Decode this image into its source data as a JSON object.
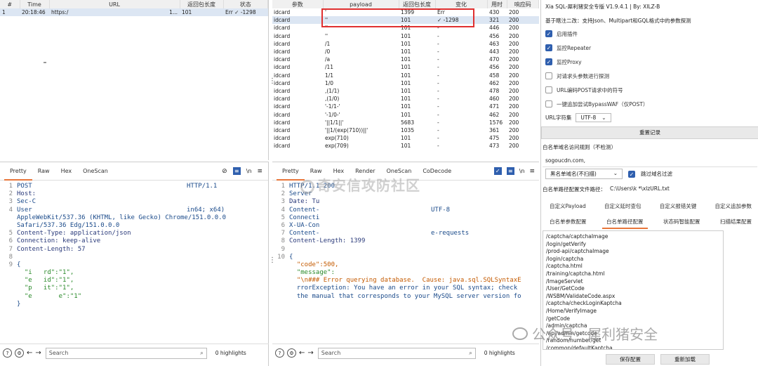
{
  "history": {
    "columns": [
      "#",
      "Time",
      "URL",
      "返回包长度",
      "状态"
    ],
    "rows": [
      {
        "num": "1",
        "time": "20:18:46",
        "url": "https:/",
        "extra": "1...",
        "len": "101",
        "status": "Err ✓ -1298"
      }
    ]
  },
  "results": {
    "columns": [
      "参数",
      "payload",
      "返回包长度",
      "变化",
      "用时",
      "响应码"
    ],
    "rows": [
      [
        "idcard",
        "'",
        "1399",
        "Err",
        "430",
        "200"
      ],
      [
        "idcard",
        "''",
        "101",
        "✓ -1298",
        "321",
        "200"
      ],
      [
        "idcard",
        "''",
        "101",
        "-",
        "446",
        "200"
      ],
      [
        "idcard",
        "''",
        "101",
        "-",
        "456",
        "200"
      ],
      [
        "idcard",
        "/1",
        "101",
        "-",
        "463",
        "200"
      ],
      [
        "idcard",
        "/0",
        "101",
        "-",
        "443",
        "200"
      ],
      [
        "idcard",
        "/a",
        "101",
        "-",
        "470",
        "200"
      ],
      [
        "idcard",
        "/11",
        "101",
        "-",
        "456",
        "200"
      ],
      [
        "idcard",
        "1/1",
        "101",
        "-",
        "458",
        "200"
      ],
      [
        "idcard",
        "1/0",
        "101",
        "-",
        "462",
        "200"
      ],
      [
        "idcard",
        ",(1/1)",
        "101",
        "-",
        "478",
        "200"
      ],
      [
        "idcard",
        ",(1/0)",
        "101",
        "-",
        "460",
        "200"
      ],
      [
        "idcard",
        "'-1/1-'",
        "101",
        "-",
        "471",
        "200"
      ],
      [
        "idcard",
        "'-1/0-'",
        "101",
        "-",
        "462",
        "200"
      ],
      [
        "idcard",
        "'||1/1||'",
        "5683",
        "-",
        "1576",
        "200"
      ],
      [
        "idcard",
        "'||1/(exp(710))||'",
        "1035",
        "-",
        "361",
        "200"
      ],
      [
        "idcard",
        "exp(710)",
        "101",
        "-",
        "475",
        "200"
      ],
      [
        "idcard",
        "exp(709)",
        "101",
        "-",
        "473",
        "200"
      ]
    ]
  },
  "request": {
    "tabs": [
      "Pretty",
      "Raw",
      "Hex",
      "OneScan"
    ],
    "lines": [
      {
        "n": "1",
        "t": "POST",
        "t2": "HTTP/1.1"
      },
      {
        "n": "2",
        "t": "Host:"
      },
      {
        "n": "3",
        "t": "Sec-C"
      },
      {
        "n": "4",
        "t": "User",
        "t2": "in64; x64)"
      },
      {
        "n": "",
        "t": "AppleWebKit/537.36 (KHTML, like Gecko) Chrome/151.0.0.0"
      },
      {
        "n": "",
        "t": "Safari/537.36 Edg/151.0.0.0"
      },
      {
        "n": "5",
        "t": "Content-Type: application/json"
      },
      {
        "n": "6",
        "t": "Connection: keep-alive"
      },
      {
        "n": "7",
        "t": "Content-Length: 57"
      },
      {
        "n": "8",
        "t": ""
      },
      {
        "n": "9",
        "t": "{"
      },
      {
        "n": "",
        "t": "  \"i   rd\":\"1\","
      },
      {
        "n": "",
        "t": "  \"e   id\":\"1\","
      },
      {
        "n": "",
        "t": "  \"p   it\":\"1\","
      },
      {
        "n": "",
        "t": "  \"e       e\":\"1\""
      },
      {
        "n": "",
        "t": "}"
      }
    ],
    "search_placeholder": "Search",
    "highlights": "0 highlights"
  },
  "response": {
    "tabs": [
      "Pretty",
      "Raw",
      "Hex",
      "Render",
      "OneScan",
      "CoDecode"
    ],
    "lines": [
      {
        "n": "1",
        "t": "HTTP/1.1 200"
      },
      {
        "n": "2",
        "t": "Server"
      },
      {
        "n": "3",
        "t": "Date: Tu"
      },
      {
        "n": "4",
        "t": "Content-",
        "t2": "UTF-8"
      },
      {
        "n": "5",
        "t": "Connecti"
      },
      {
        "n": "6",
        "t": "X-UA-Con"
      },
      {
        "n": "7",
        "t": "Content-",
        "t2": "e-requests"
      },
      {
        "n": "8",
        "t": "Content-Length: 1399"
      },
      {
        "n": "9",
        "t": ""
      },
      {
        "n": "10",
        "t": "{"
      },
      {
        "n": "",
        "t": "  \"code\":500,"
      },
      {
        "n": "",
        "t": "  \"message\":"
      },
      {
        "n": "",
        "t": "  \"\\n### Error querying database.  Cause: java.sql.SQLSyntaxE"
      },
      {
        "n": "",
        "t": "  rrorException: You have an error in your SQL syntax; check"
      },
      {
        "n": "",
        "t": "  the manual that corresponds to your MySQL server version fo"
      }
    ],
    "search_placeholder": "Search",
    "highlights": "0 highlights"
  },
  "plugin": {
    "title": "Xia SQL-犀利猪安全专版 V1.9.4.1 | By: XILZ-B",
    "desc": "基于瞎注二改：支持Json、Multipart和GQL格式中的参数探测",
    "checks": [
      {
        "label": "启用插件",
        "on": true
      },
      {
        "label": "监控Repeater",
        "on": true
      },
      {
        "label": "监控Proxy",
        "on": true
      },
      {
        "label": "对请求头参数进行探测",
        "on": false
      },
      {
        "label": "URL编码POST请求中的符号",
        "on": false
      },
      {
        "label": "一键追加尝试BypassWAF（仅POST）",
        "on": false
      }
    ],
    "charset_label": "URL字符集",
    "charset_value": "UTF-8",
    "reset_label": "重置记录",
    "whitelist_label": "白名单域名访问规则（不检测）",
    "domain_value": "sogoucdn.com,",
    "mode_value": "黑名单域名(不扫描)",
    "skip_label": "跳过域名过滤",
    "path_label": "白名单路径配置文件路径：",
    "path_value": "C:\\Users\\k     *\\xlzURL.txt",
    "tabs_row1": [
      "自定义Payload",
      "自定义延时查包",
      "自定义报错关键",
      "自定义追加参数"
    ],
    "tabs_row2": [
      "白名单参数配置",
      "白名单路径配置",
      "状态码智能配置",
      "扫描结果配置"
    ],
    "paths": [
      "/captcha/captchaImage",
      "/login/getVerify",
      "/prod-api/captchaImage",
      "/login/captcha",
      "/captcha.html",
      "/training/captcha.html",
      "/ImageServlet",
      "/User/GetCode",
      "/WSBM/ValidateCode.aspx",
      "/captcha/checkLoginKaptcha",
      "/Home/VerifyImage",
      "/getCode",
      "/admin/captcha",
      "/api/admin/getcode",
      "/random/number/get",
      "/common/defaultKaptcha"
    ],
    "save_label": "保存配置",
    "reload_label": "重新加载"
  },
  "watermark": {
    "center": "奇安信攻防社区",
    "corner": "公众号 · 犀利猪安全"
  },
  "colors": {
    "accent": "#e8763a",
    "highlight": "#e03030",
    "checkbox": "#2f5fae"
  }
}
